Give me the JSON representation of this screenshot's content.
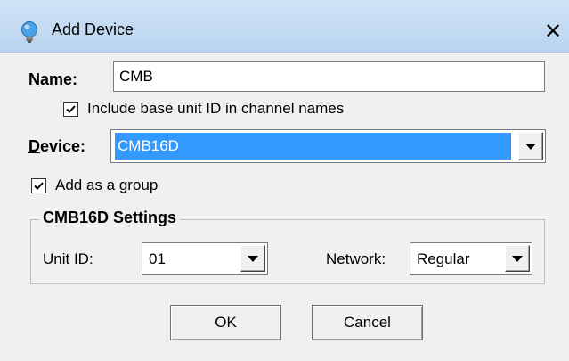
{
  "window": {
    "title": "Add Device",
    "icon": "lightbulb-icon",
    "close_glyph": "✕"
  },
  "name": {
    "label_mnemonic": "N",
    "label_rest": "ame:",
    "value": "CMB"
  },
  "include_base_unit": {
    "label": "Include base unit ID in channel names",
    "checked": true
  },
  "device": {
    "label_mnemonic": "D",
    "label_rest": "evice:",
    "selected": "CMB16D"
  },
  "add_as_group": {
    "label_pre": "Add as a ",
    "label_mnemonic": "g",
    "label_post": "roup",
    "checked": true
  },
  "settings_group": {
    "title": "CMB16D Settings",
    "unit_id_label": "Unit ID:",
    "unit_id_value": "01",
    "network_label": "Network:",
    "network_value": "Regular"
  },
  "buttons": {
    "ok": "OK",
    "cancel": "Cancel"
  },
  "colors": {
    "selection": "#3399ff",
    "titlebar": "#c4dbf2"
  }
}
